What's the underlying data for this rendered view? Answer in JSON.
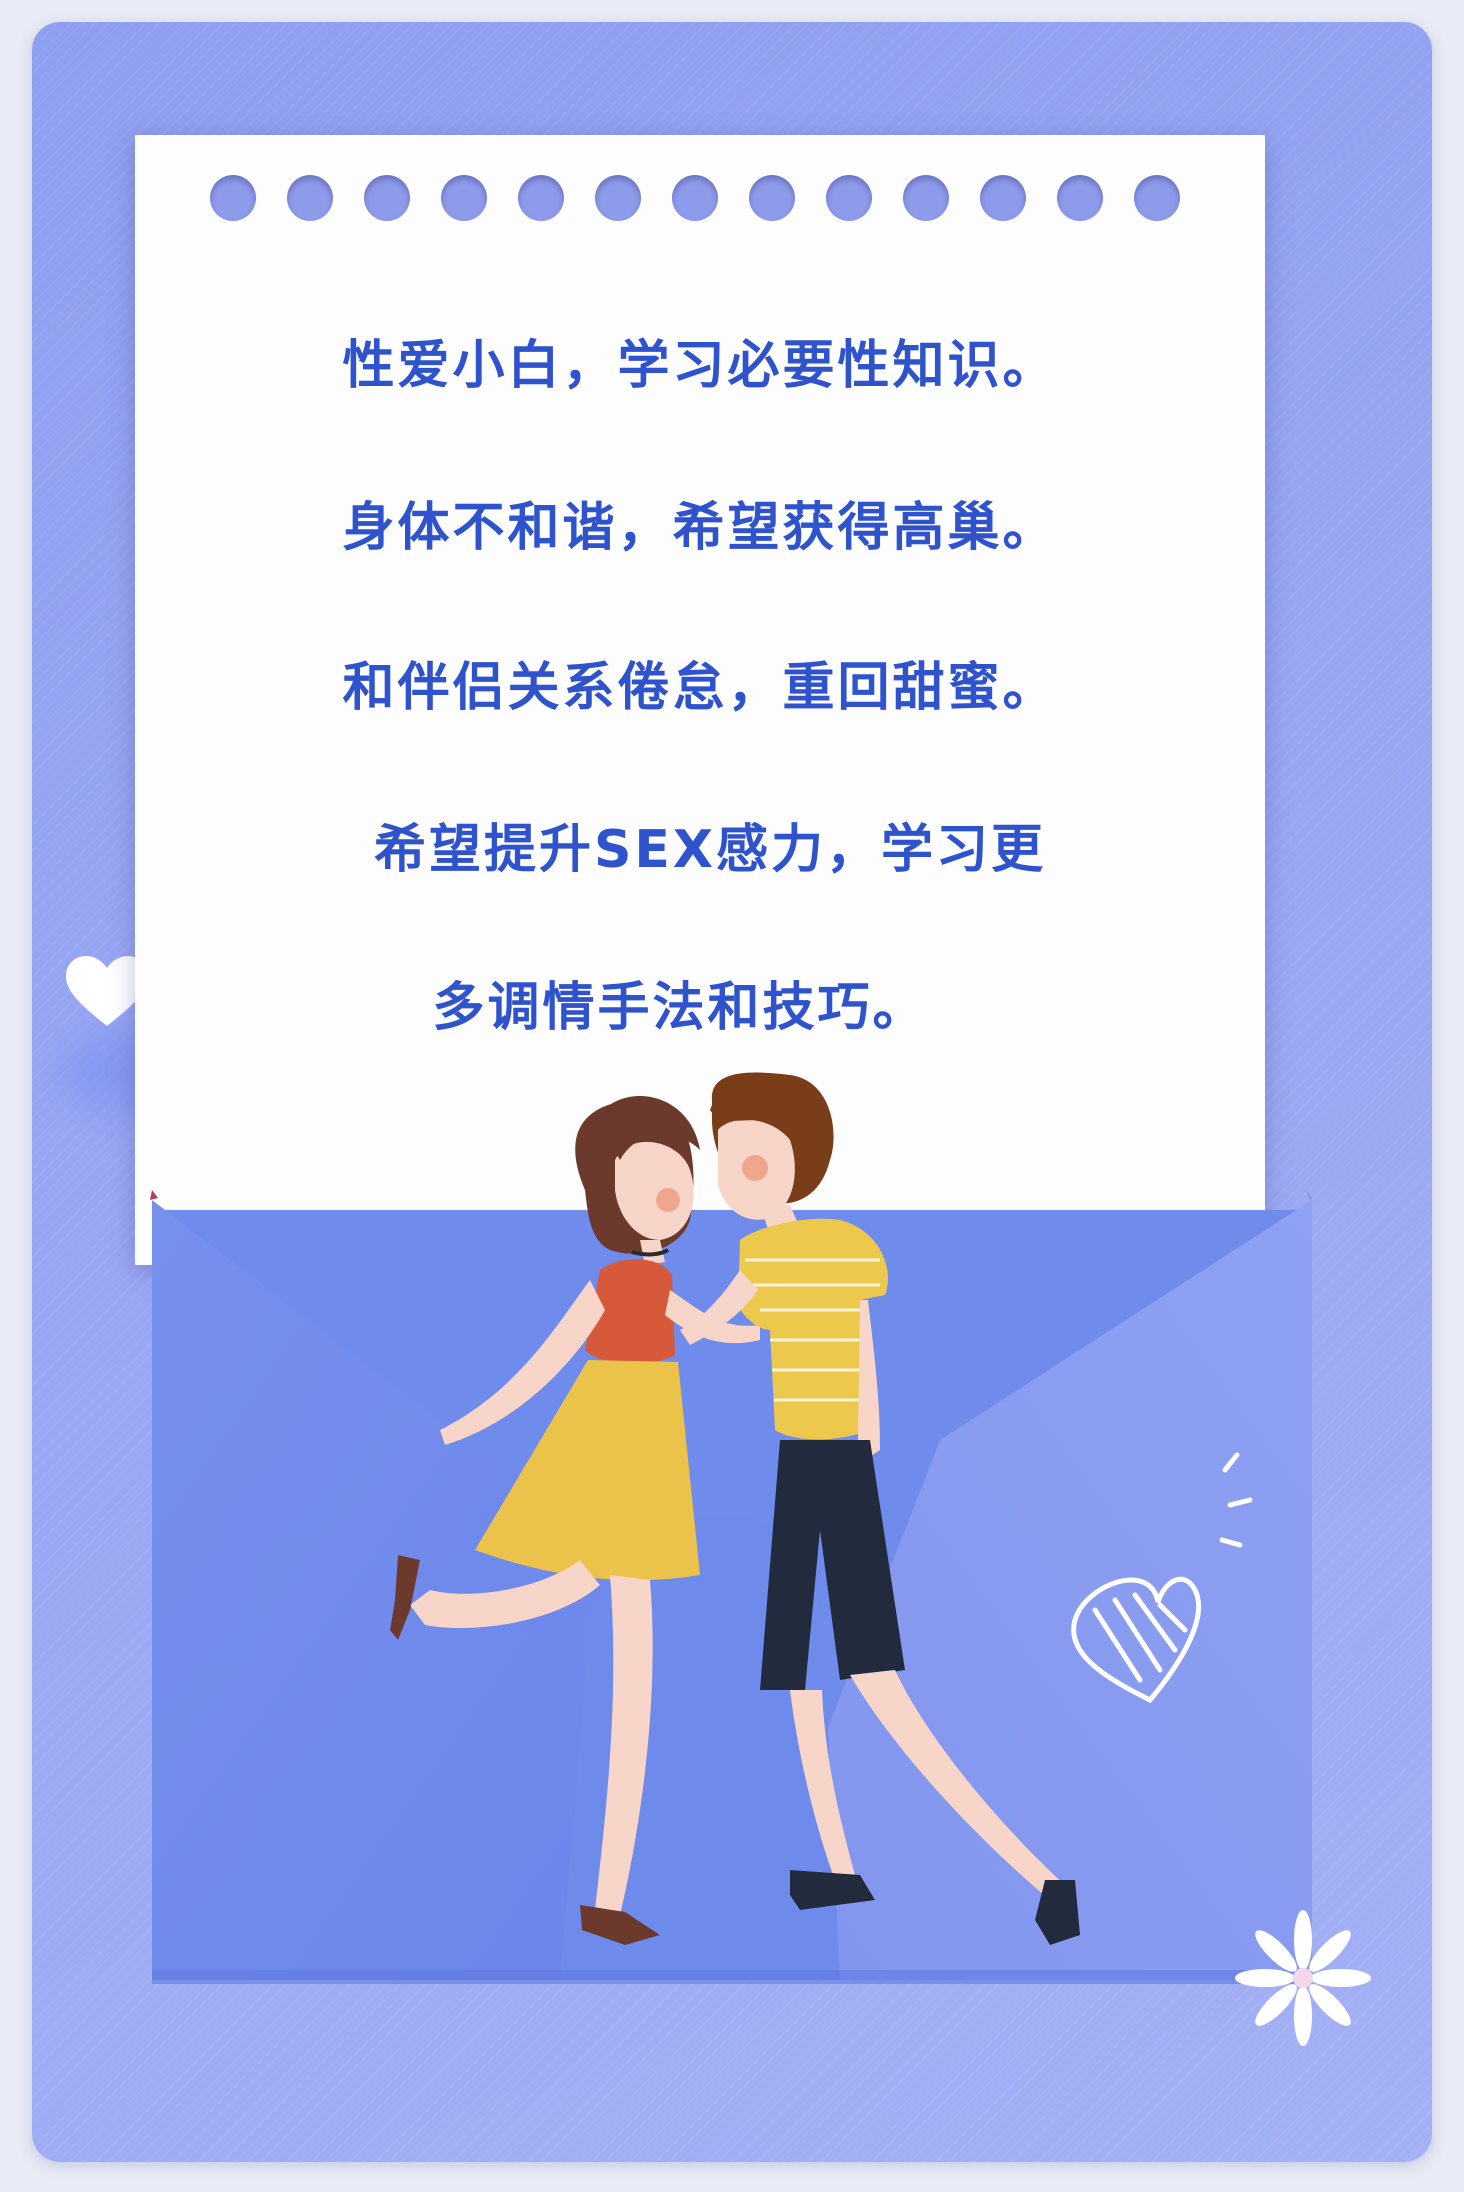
{
  "letter": {
    "lines": [
      "性爱小白，学习必要性知识。",
      "身体不和谐，希望获得高巢。",
      "和伴侣关系倦怠，重回甜蜜。",
      "希望提升SEX感力，学习更",
      "多调情手法和技巧。"
    ]
  },
  "icons": {
    "side_heart": "heart-icon",
    "doodle_heart": "doodle-heart-icon",
    "flower": "flower-icon"
  },
  "colors": {
    "text": "#2f53cc",
    "card_bg": "#9aa8f3",
    "envelope": "#6b89ec"
  }
}
